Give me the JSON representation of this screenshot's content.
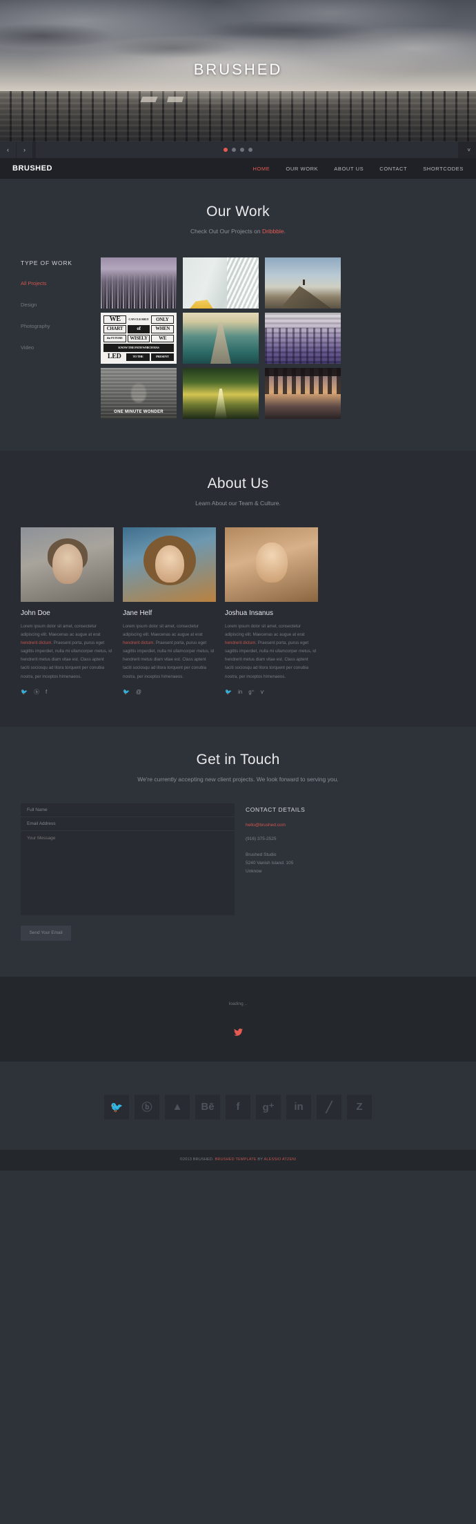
{
  "hero": {
    "title": "BRUSHED",
    "slider": {
      "prev_label": "‹",
      "next_label": "›",
      "collapse_label": "˅",
      "dots": 4,
      "active_dot": 0
    }
  },
  "nav": {
    "brand": "BRUSHED",
    "links": [
      {
        "label": "HOME",
        "active": true
      },
      {
        "label": "OUR WORK",
        "active": false
      },
      {
        "label": "ABOUT US",
        "active": false
      },
      {
        "label": "CONTACT",
        "active": false
      },
      {
        "label": "SHORTCODES",
        "active": false
      }
    ]
  },
  "work": {
    "title": "Our Work",
    "subtitle_prefix": "Check Out Our Projects on ",
    "subtitle_link": "Dribbble",
    "subtitle_suffix": ".",
    "filter_title": "TYPE OF WORK",
    "filters": [
      {
        "label": "All Projects",
        "active": true
      },
      {
        "label": "Design",
        "active": false
      },
      {
        "label": "Photography",
        "active": false
      },
      {
        "label": "Video",
        "active": false
      }
    ],
    "tiles": [
      {
        "name": "city-skyline-thumbnail",
        "art": "t-city"
      },
      {
        "name": "office-interior-thumbnail",
        "art": "t-office"
      },
      {
        "name": "mountain-peak-thumbnail",
        "art": "t-peak"
      },
      {
        "name": "typography-poster-thumbnail",
        "art": "t-typo"
      },
      {
        "name": "pier-sunset-thumbnail",
        "art": "t-pier"
      },
      {
        "name": "purple-boardwalk-thumbnail",
        "art": "t-deck"
      },
      {
        "name": "one-minute-wonder-thumbnail",
        "art": "t-omw"
      },
      {
        "name": "green-road-thumbnail",
        "art": "t-road"
      },
      {
        "name": "under-pier-thumbnail",
        "art": "t-under"
      }
    ],
    "typography_tile": {
      "l1a": "WE",
      "l1b": "CAN CLEARLY",
      "l1c": "ONLY",
      "l2a": "CHART",
      "l2b": "of",
      "l2c": "WHEN",
      "l3a": "the FUTURE",
      "l3b": "WISELY",
      "l3c": "WE",
      "l4": "KNOW THE PATH WHICH HAS",
      "l5a": "LED",
      "l5b": "TO THE",
      "l5c": "PRESENT"
    },
    "video_tile_caption": "ONE\nMINUTE\nWONDER"
  },
  "about": {
    "title": "About Us",
    "subtitle": "Learn About our Team & Culture.",
    "members": [
      {
        "name": "John Doe",
        "bio_1": "Lorem ipsum dolor sit amet, consectetur adipiscing elit. Maecenas ac augue at erat ",
        "bio_link": "hendrerit dictum",
        "bio_2": ". Praesent porta, purus eget sagittis imperdiet, nulla mi ullamcorper metus, id hendrerit metus diam vitae est. Class aptent taciti sociosqu ad litora torquent per conubia nostra, per inceptos himenaeos.",
        "socials": [
          "twitter-icon",
          "dribbble-icon",
          "facebook-icon"
        ],
        "social_glyphs": [
          "🐦",
          "ⓑ",
          "f"
        ]
      },
      {
        "name": "Jane Helf",
        "bio_1": "Lorem ipsum dolor sit amet, consectetur adipiscing elit. Maecenas ac augue at erat ",
        "bio_link": "hendrerit dictum",
        "bio_2": ". Praesent porta, purus eget sagittis imperdiet, nulla mi ullamcorper metus, id hendrerit metus diam vitae est. Class aptent taciti sociosqu ad litora torquent per conubia nostra, per inceptos himenaeos.",
        "socials": [
          "twitter-icon",
          "instagram-icon"
        ],
        "social_glyphs": [
          "🐦",
          "@"
        ]
      },
      {
        "name": "Joshua Insanus",
        "bio_1": "Lorem ipsum dolor sit amet, consectetur adipiscing elit. Maecenas ac augue at erat ",
        "bio_link": "hendrerit dictum",
        "bio_2": ". Praesent porta, purus eget sagittis imperdiet, nulla mi ullamcorper metus, id hendrerit metus diam vitae est. Class aptent taciti sociosqu ad litora torquent per conubia nostra, per inceptos himenaeos.",
        "socials": [
          "twitter-icon",
          "linkedin-icon",
          "google-plus-icon",
          "vimeo-icon"
        ],
        "social_glyphs": [
          "🐦",
          "in",
          "g⁺",
          "ѵ"
        ]
      }
    ]
  },
  "contact": {
    "title": "Get in Touch",
    "subtitle": "We're currently accepting new client projects. We look forward to serving you.",
    "form": {
      "name_placeholder": "Full Name",
      "name_value": "",
      "email_placeholder": "Email Address",
      "email_value": "",
      "message_placeholder": "Your Message",
      "message_value": "",
      "submit_label": "Send Your Email"
    },
    "details": {
      "title": "CONTACT DETAILS",
      "email": "hello@brushed.com",
      "phone": "(916) 375-2525",
      "address_line1": "Brushed Studio",
      "address_line2": "5240 Vanish Island. 105",
      "address_line3": "Unknow"
    }
  },
  "feed": {
    "loading_text": "loading ..",
    "icon": "twitter-icon"
  },
  "social_footer": {
    "items": [
      {
        "name": "twitter-icon",
        "glyph": "🐦"
      },
      {
        "name": "dribbble-icon",
        "glyph": "ⓑ"
      },
      {
        "name": "forrst-icon",
        "glyph": "▲"
      },
      {
        "name": "behance-icon",
        "glyph": "Bē"
      },
      {
        "name": "facebook-icon",
        "glyph": "f"
      },
      {
        "name": "google-plus-icon",
        "glyph": "g⁺"
      },
      {
        "name": "linkedin-icon",
        "glyph": "in"
      },
      {
        "name": "evernote-icon",
        "glyph": "╱"
      },
      {
        "name": "zerply-icon",
        "glyph": "Z"
      }
    ]
  },
  "footer": {
    "copy_prefix": "©2013 BRUSHED. ",
    "template_link": "BRUSHED TEMPLATE",
    "copy_mid": " BY ",
    "author_link": "ALESSIO ATZENI"
  },
  "colors": {
    "accent": "#e55b53",
    "bg_dark": "#24272c",
    "bg_mid": "#2e3239",
    "bg_alt": "#292c33",
    "text_muted": "#7e8188"
  }
}
